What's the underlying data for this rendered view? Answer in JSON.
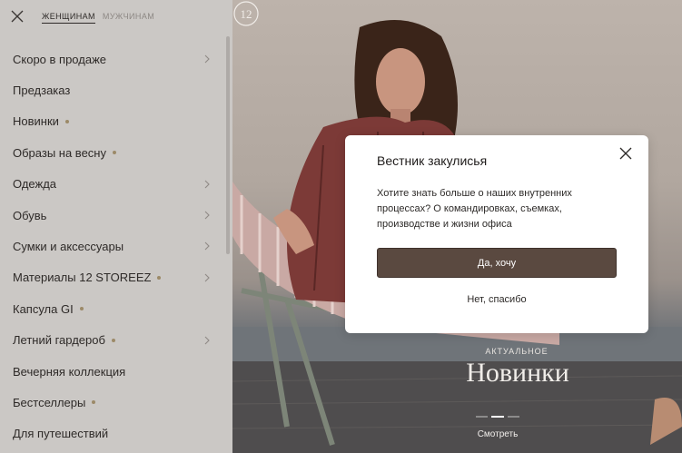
{
  "menu": {
    "tabs": [
      {
        "label": "ЖЕНЩИНАМ",
        "active": true
      },
      {
        "label": "МУЖЧИНАМ",
        "active": false
      }
    ],
    "items": [
      {
        "label": "Скоро в продаже",
        "dot": false,
        "chevron": true
      },
      {
        "label": "Предзаказ",
        "dot": false,
        "chevron": false
      },
      {
        "label": "Новинки",
        "dot": true,
        "chevron": false
      },
      {
        "label": "Образы на весну",
        "dot": true,
        "chevron": false
      },
      {
        "label": "Одежда",
        "dot": false,
        "chevron": true
      },
      {
        "label": "Обувь",
        "dot": false,
        "chevron": true
      },
      {
        "label": "Сумки и аксессуары",
        "dot": false,
        "chevron": true
      },
      {
        "label": "Материалы 12 STOREEZ",
        "dot": true,
        "chevron": true
      },
      {
        "label": "Капсула GI",
        "dot": true,
        "chevron": false
      },
      {
        "label": "Летний гардероб",
        "dot": true,
        "chevron": true
      },
      {
        "label": "Вечерняя коллекция",
        "dot": false,
        "chevron": false
      },
      {
        "label": "Бестселлеры",
        "dot": true,
        "chevron": false
      },
      {
        "label": "Для путешествий",
        "dot": false,
        "chevron": false
      }
    ]
  },
  "hero": {
    "logo": "12",
    "kicker": "АКТУАЛЬНОЕ",
    "title": "Новинки",
    "cta": "Смотреть",
    "slides_total": 3,
    "slide_active": 2
  },
  "modal": {
    "title": "Вестник закулисья",
    "text": "Хотите знать больше о наших внутренних процессах? О командировках, съемках, производстве и жизни офиса",
    "yes_label": "Да, хочу",
    "no_label": "Нет, спасибо"
  },
  "colors": {
    "menu_bg": "#cbc8c5",
    "accent_dot": "#9c8a68",
    "primary_button": "#5a4940"
  }
}
